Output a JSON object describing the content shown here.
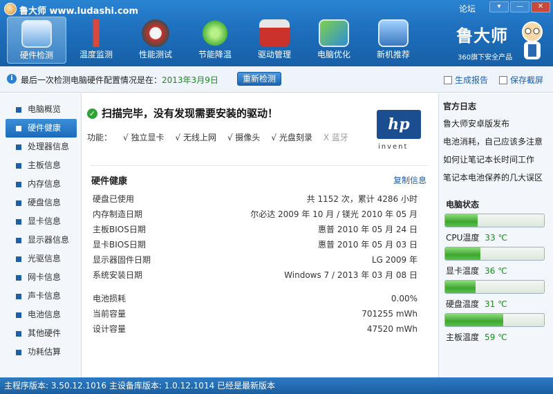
{
  "app": {
    "title": "鲁大师 www.ludashi.com",
    "forum": "论坛",
    "window_buttons": [
      "▾",
      "—",
      "✕"
    ]
  },
  "nav": [
    {
      "label": "硬件检测",
      "icon": "monitor-magnifier-icon",
      "active": true
    },
    {
      "label": "温度监测",
      "icon": "thermometer-icon",
      "active": false
    },
    {
      "label": "性能测试",
      "icon": "speedometer-icon",
      "active": false
    },
    {
      "label": "节能降温",
      "icon": "clover-leaf-icon",
      "active": false
    },
    {
      "label": "驱动管理",
      "icon": "toolbox-gear-icon",
      "active": false
    },
    {
      "label": "电脑优化",
      "icon": "monitor-broom-icon",
      "active": false
    },
    {
      "label": "新机推荐",
      "icon": "computer-medal-icon",
      "active": false
    }
  ],
  "brand": {
    "title": "鲁大师",
    "subtitle": "360旗下安全产品"
  },
  "infobar": {
    "prefix": "最后一次检测电脑硬件配置情况是在：",
    "date": "2013年3月9日",
    "recheck": "重新检测",
    "report": "生成报告",
    "screenshot": "保存截屏"
  },
  "sidebar": [
    {
      "label": "电脑概览",
      "active": false
    },
    {
      "label": "硬件健康",
      "active": true
    },
    {
      "label": "处理器信息",
      "active": false
    },
    {
      "label": "主板信息",
      "active": false
    },
    {
      "label": "内存信息",
      "active": false
    },
    {
      "label": "硬盘信息",
      "active": false
    },
    {
      "label": "显卡信息",
      "active": false
    },
    {
      "label": "显示器信息",
      "active": false
    },
    {
      "label": "光驱信息",
      "active": false
    },
    {
      "label": "网卡信息",
      "active": false
    },
    {
      "label": "声卡信息",
      "active": false
    },
    {
      "label": "电池信息",
      "active": false
    },
    {
      "label": "其他硬件",
      "active": false
    },
    {
      "label": "功耗估算",
      "active": false
    }
  ],
  "main": {
    "scan_title": "扫描完毕，没有发现需要安装的驱动！",
    "func_label": "功能：",
    "features": [
      {
        "label": "√ 独立显卡",
        "enabled": true
      },
      {
        "label": "√ 无线上网",
        "enabled": true
      },
      {
        "label": "√ 摄像头",
        "enabled": true
      },
      {
        "label": "√ 光盘刻录",
        "enabled": true
      },
      {
        "label": "X 蓝牙",
        "enabled": false
      }
    ],
    "logo_text": "hp",
    "logo_sub": "invent",
    "section_title": "硬件健康",
    "copy": "复制信息",
    "rows": [
      {
        "key": "硬盘已使用",
        "value": "共 1152 次，累计 4286 小时"
      },
      {
        "key": "内存制造日期",
        "value": "尔必达 2009 年 10 月 / 镁光 2010 年 05 月"
      },
      {
        "key": "主板BIOS日期",
        "value": "惠普 2010 年 05 月 24 日"
      },
      {
        "key": "显卡BIOS日期",
        "value": "惠普 2010 年 05 月 03 日"
      },
      {
        "key": "显示器固件日期",
        "value": "LG 2009 年"
      },
      {
        "key": "系统安装日期",
        "value": "Windows 7 / 2013 年 03 月 08 日"
      }
    ],
    "battery_rows": [
      {
        "key": "电池损耗",
        "value": "0.00%"
      },
      {
        "key": "当前容量",
        "value": "701255 mWh"
      },
      {
        "key": "设计容量",
        "value": "47520 mWh"
      }
    ]
  },
  "right": {
    "log_title": "官方日志",
    "logs": [
      "鲁大师安卓版发布",
      "电池消耗，自己应该多注意",
      "如何让笔记本长时间工作",
      "笔记本电池保养的几大误区"
    ],
    "status_title": "电脑状态",
    "temps": [
      {
        "label": "CPU温度",
        "value": "33 ℃",
        "level": 0.33
      },
      {
        "label": "显卡温度",
        "value": "36 ℃",
        "level": 0.36
      },
      {
        "label": "硬盘温度",
        "value": "31 ℃",
        "level": 0.31
      },
      {
        "label": "主板温度",
        "value": "59 ℃",
        "level": 0.59
      }
    ]
  },
  "status": {
    "text": "主程序版本: 3.50.12.1016   主设备库版本: 1.0.12.1014   已经是最新版本"
  }
}
